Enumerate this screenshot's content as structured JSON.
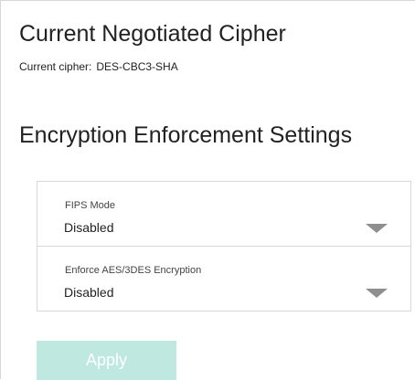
{
  "cipher_section": {
    "title": "Current Negotiated Cipher",
    "current_label": "Current cipher:",
    "current_value": "DES-CBC3-SHA"
  },
  "encryption_section": {
    "title": "Encryption Enforcement Settings",
    "settings": [
      {
        "label": "FIPS Mode",
        "value": "Disabled"
      },
      {
        "label": "Enforce AES/3DES Encryption",
        "value": "Disabled"
      }
    ],
    "apply_label": "Apply",
    "apply_enabled": false
  },
  "colors": {
    "apply_button_disabled_bg": "#bfe9e0",
    "dropdown_caret": "#8f8f8f",
    "border": "#d8d8d8"
  },
  "icons": {
    "dropdown": "caret-down-icon"
  }
}
